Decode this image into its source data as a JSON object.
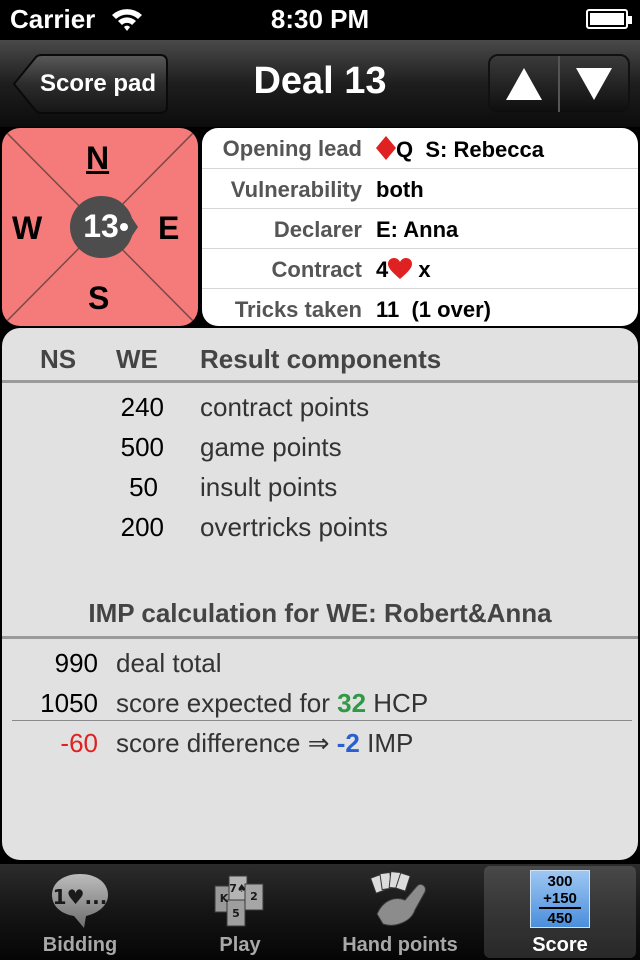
{
  "status": {
    "carrier": "Carrier",
    "time": "8:30 PM"
  },
  "nav": {
    "back_label": "Score pad",
    "title": "Deal 13"
  },
  "compass": {
    "north": "N",
    "south": "S",
    "west": "W",
    "east": "E",
    "deal_number": "13",
    "color": "#f47b79"
  },
  "info": {
    "opening_lead_label": "Opening lead",
    "opening_lead_card": "Q",
    "opening_lead_player": "S: Rebecca",
    "vulnerability_label": "Vulnerability",
    "vulnerability_value": "both",
    "declarer_label": "Declarer",
    "declarer_value": "E: Anna",
    "contract_label": "Contract",
    "contract_level": "4",
    "contract_double": "x",
    "tricks_label": "Tricks taken",
    "tricks_value": "11  (1 over)"
  },
  "result": {
    "col_ns": "NS",
    "col_we": "WE",
    "col_components": "Result components",
    "components": [
      {
        "we": "240",
        "label": "contract points"
      },
      {
        "we": "500",
        "label": "game points"
      },
      {
        "we": "50",
        "label": "insult points"
      },
      {
        "we": "200",
        "label": "overtricks points"
      }
    ],
    "imp_title": "IMP calculation for WE: Robert&Anna",
    "deal_total_value": "990",
    "deal_total_label": "deal total",
    "expected_value": "1050",
    "expected_prefix": "score expected for",
    "expected_hcp": "32",
    "expected_suffix": "HCP",
    "difference_value": "-60",
    "difference_prefix": "score difference ⇒",
    "difference_imp": "-2",
    "difference_suffix": "IMP"
  },
  "tabs": [
    {
      "label": "Bidding",
      "icon": "speech-bubble-icon"
    },
    {
      "label": "Play",
      "icon": "cards-icon"
    },
    {
      "label": "Hand points",
      "icon": "arm-with-cards-icon"
    },
    {
      "label": "Score",
      "icon": "score-sheet-icon",
      "selected": true
    }
  ],
  "score_icon": {
    "line1": "300",
    "line2": "+150",
    "line3": "450"
  },
  "colors": {
    "green_hcp": "#2e9a45",
    "blue_imp": "#2a5fcf",
    "red_diff": "#e02121",
    "suit_red": "#e02121"
  }
}
